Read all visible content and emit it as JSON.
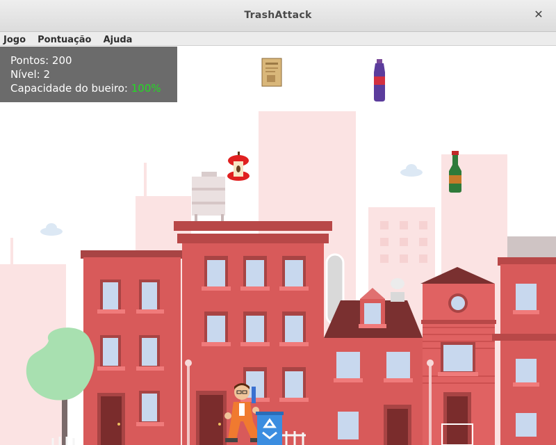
{
  "window": {
    "title": "TrashAttack"
  },
  "menu": [
    "Jogo",
    "Pontuação",
    "Ajuda"
  ],
  "hud": {
    "score_label": "Pontos:",
    "score": "200",
    "level_label": "Nível:",
    "level": "2",
    "capacity_label": "Capacidade do bueiro:",
    "capacity": "100%",
    "capacity_color": "#22dd22"
  },
  "colors": {
    "building": "#d95b5b",
    "building_dark": "#b84848",
    "background_building": "#fbe4e4",
    "tree": "#a8e0b0",
    "recycle_bin": "#3b8de0"
  }
}
